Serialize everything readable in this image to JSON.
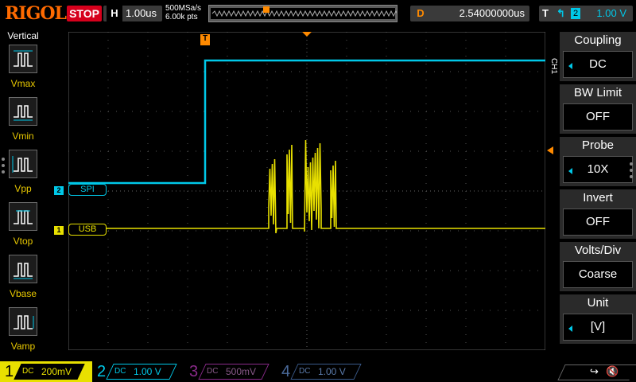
{
  "header": {
    "logo": "RIGOL",
    "run_state": "STOP",
    "horizontal": {
      "label": "H",
      "timebase": "1.00us"
    },
    "sample_rate": "500MSa/s",
    "memory_depth": "6.00k pts",
    "delay": {
      "label": "D",
      "value": "2.54000000us"
    },
    "trigger": {
      "label": "T",
      "edge_icon": "rising-edge-icon",
      "source": "2",
      "level": "1.00 V"
    }
  },
  "left_panel": {
    "title": "Vertical",
    "measurements": [
      {
        "label": "Vmax",
        "icon": "vmax-icon"
      },
      {
        "label": "Vmin",
        "icon": "vmin-icon"
      },
      {
        "label": "Vpp",
        "icon": "vpp-icon"
      },
      {
        "label": "Vtop",
        "icon": "vtop-icon"
      },
      {
        "label": "Vbase",
        "icon": "vbase-icon"
      },
      {
        "label": "Vamp",
        "icon": "vamp-icon"
      }
    ]
  },
  "waveform": {
    "trigger_marker": "T",
    "channel_labels": [
      {
        "channel": "2",
        "name": "SPI",
        "color": "#00c8e8"
      },
      {
        "channel": "1",
        "name": "USB",
        "color": "#e8e000"
      }
    ]
  },
  "menu": {
    "channel": "CH1",
    "items": [
      {
        "title": "Coupling",
        "value": "DC",
        "has_arrow": true
      },
      {
        "title": "BW Limit",
        "value": "OFF",
        "has_arrow": false
      },
      {
        "title": "Probe",
        "value": "10X",
        "has_arrow": true
      },
      {
        "title": "Invert",
        "value": "OFF",
        "has_arrow": false
      },
      {
        "title": "Volts/Div",
        "value": "Coarse",
        "has_arrow": false
      },
      {
        "title": "Unit",
        "value": "[V]",
        "has_arrow": true
      }
    ]
  },
  "channels": [
    {
      "number": "1",
      "coupling": "DC",
      "scale": "200mV",
      "active": true,
      "color": "#e8e000"
    },
    {
      "number": "2",
      "coupling": "DC",
      "scale": "1.00 V",
      "active": false,
      "color": "#00c8e8"
    },
    {
      "number": "3",
      "coupling": "DC",
      "scale": "500mV",
      "active": false,
      "color": "#c000c0"
    },
    {
      "number": "4",
      "coupling": "DC",
      "scale": "1.00 V",
      "active": false,
      "color": "#3a7ad8"
    }
  ],
  "status_icons": [
    "usb-icon",
    "mute-icon"
  ]
}
